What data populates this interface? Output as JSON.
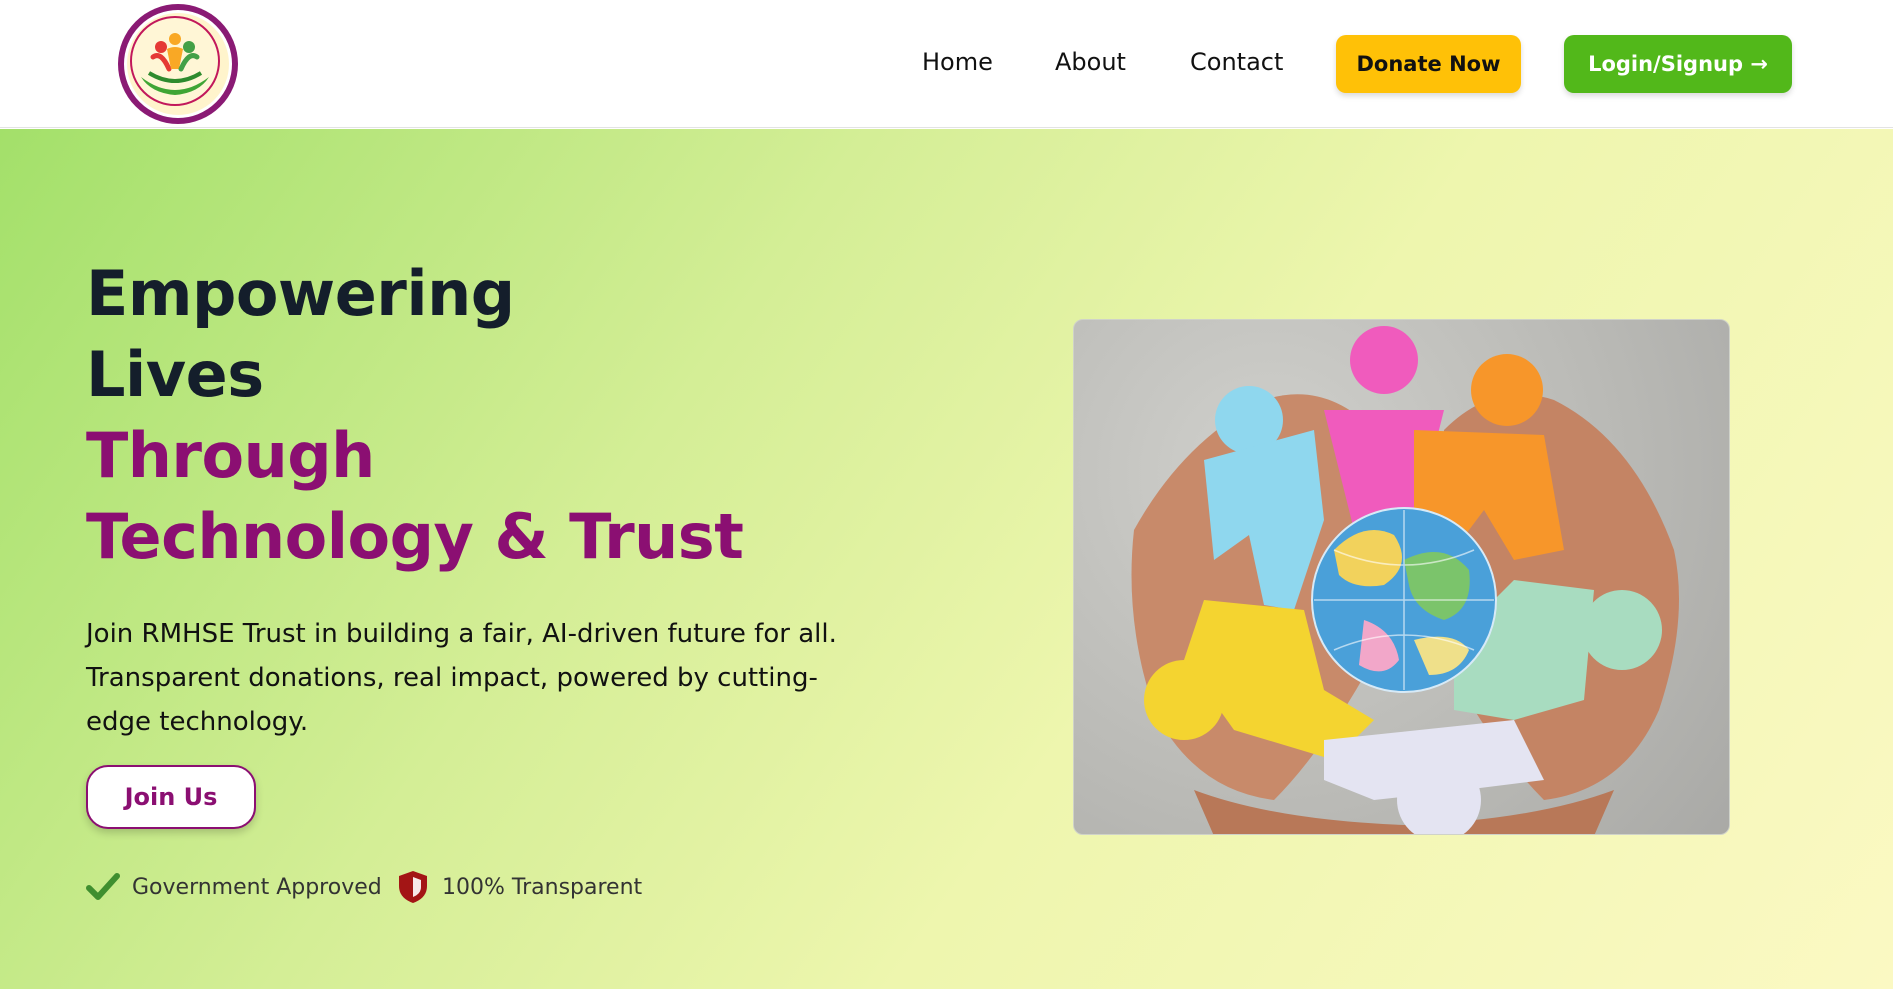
{
  "header": {
    "nav": {
      "home": "Home",
      "about": "About",
      "contact": "Contact"
    },
    "donate_label": "Donate Now",
    "login_label": "Login/Signup →"
  },
  "hero": {
    "headline_line1": "Empowering",
    "headline_line2": "Lives",
    "headline_line3": "Through",
    "headline_line4": "Technology & Trust",
    "subtitle": "Join RMHSE Trust in building a fair, AI-driven future for all. Transparent donations, real impact, powered by cutting-edge technology.",
    "join_label": "Join Us",
    "badges": [
      {
        "label": "Government Approved",
        "icon": "check-icon"
      },
      {
        "label": "100% Transparent",
        "icon": "shield-icon"
      }
    ]
  },
  "colors": {
    "accent": "#8b0f72",
    "donate": "#ffc107",
    "login": "#52b81a"
  }
}
